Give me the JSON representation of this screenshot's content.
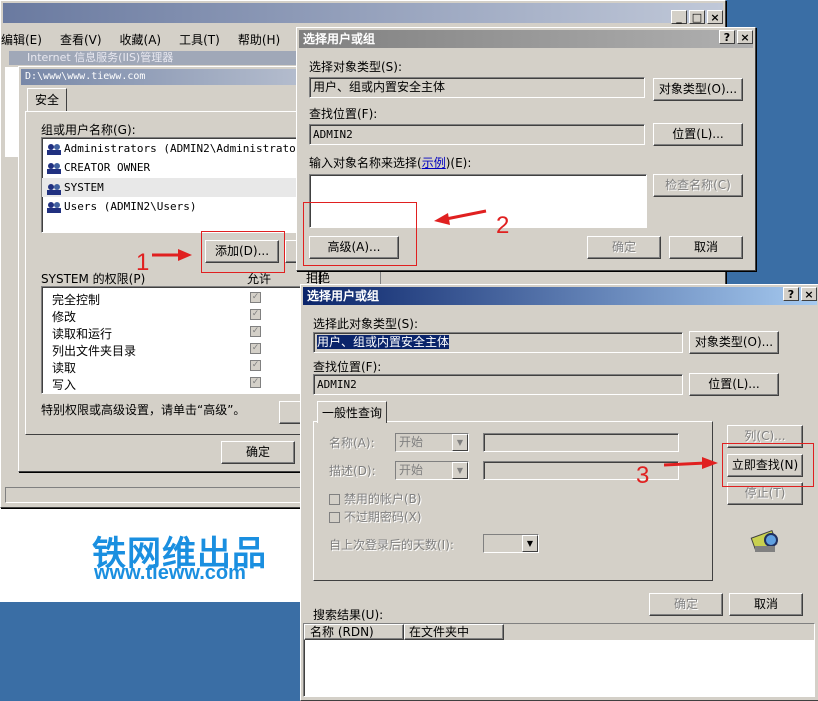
{
  "bg_window": {
    "menu": [
      "编辑(E)",
      "查看(V)",
      "收藏(A)",
      "工具(T)",
      "帮助(H)"
    ],
    "iis_title": "Internet 信息服务(IIS)管理器",
    "path_title": "D:\\www\\www.tieww.com",
    "tab_security": "安全",
    "group_label": "组或用户名称(G):",
    "users": [
      "Administrators (ADMIN2\\Administrators)",
      "CREATOR OWNER",
      "SYSTEM",
      "Users (ADMIN2\\Users)"
    ],
    "add_button": "添加(D)...",
    "perm_label": "SYSTEM 的权限(P)",
    "allow_header": "允许",
    "deny_header": "拒绝",
    "permissions": [
      "完全控制",
      "修改",
      "读取和运行",
      "列出文件夹目录",
      "读取",
      "写入"
    ],
    "special_text": "特别权限或高级设置，请单击“高级”。",
    "ok_button": "确定"
  },
  "dialog1": {
    "title": "选择用户或组",
    "obj_type_label": "选择对象类型(S):",
    "obj_type_value": "用户、组或内置安全主体",
    "obj_type_button": "对象类型(O)...",
    "location_label": "查找位置(F):",
    "location_value": "ADMIN2",
    "location_button": "位置(L)...",
    "enter_label": "输入对象名称来选择",
    "example_link": "示例",
    "enter_label_tail": "(E):",
    "check_names_button": "检查名称(C)",
    "advanced_button": "高级(A)...",
    "ok_button": "确定",
    "cancel_button": "取消"
  },
  "dialog2": {
    "title": "选择用户或组",
    "obj_type_label": "选择此对象类型(S):",
    "obj_type_value": "用户、组或内置安全主体",
    "obj_type_button": "对象类型(O)...",
    "location_label": "查找位置(F):",
    "location_value": "ADMIN2",
    "location_button": "位置(L)...",
    "tab_general": "一般性查询",
    "name_label": "名称(A):",
    "name_select": "开始",
    "desc_label": "描述(D):",
    "desc_select": "开始",
    "disabled_accounts": "禁用的帐户(B)",
    "no_expire_pwd": "不过期密码(X)",
    "days_since_login": "自上次登录后的天数(I):",
    "columns_button": "列(C)...",
    "find_now_button": "立即查找(N)",
    "stop_button": "停止(T)",
    "search_results_label": "搜索结果(U):",
    "col_name": "名称 (RDN)",
    "col_folder": "在文件夹中",
    "ok_button": "确定",
    "cancel_button": "取消"
  },
  "annotations": {
    "step1": "1",
    "step2": "2",
    "step3": "3"
  },
  "watermark": {
    "cn": "铁网维出品",
    "url": "www.tieww.com"
  },
  "colors": {
    "accent_red": "#e02020",
    "watermark_blue": "#1a8fe0",
    "title_blue": "#0a246a"
  }
}
